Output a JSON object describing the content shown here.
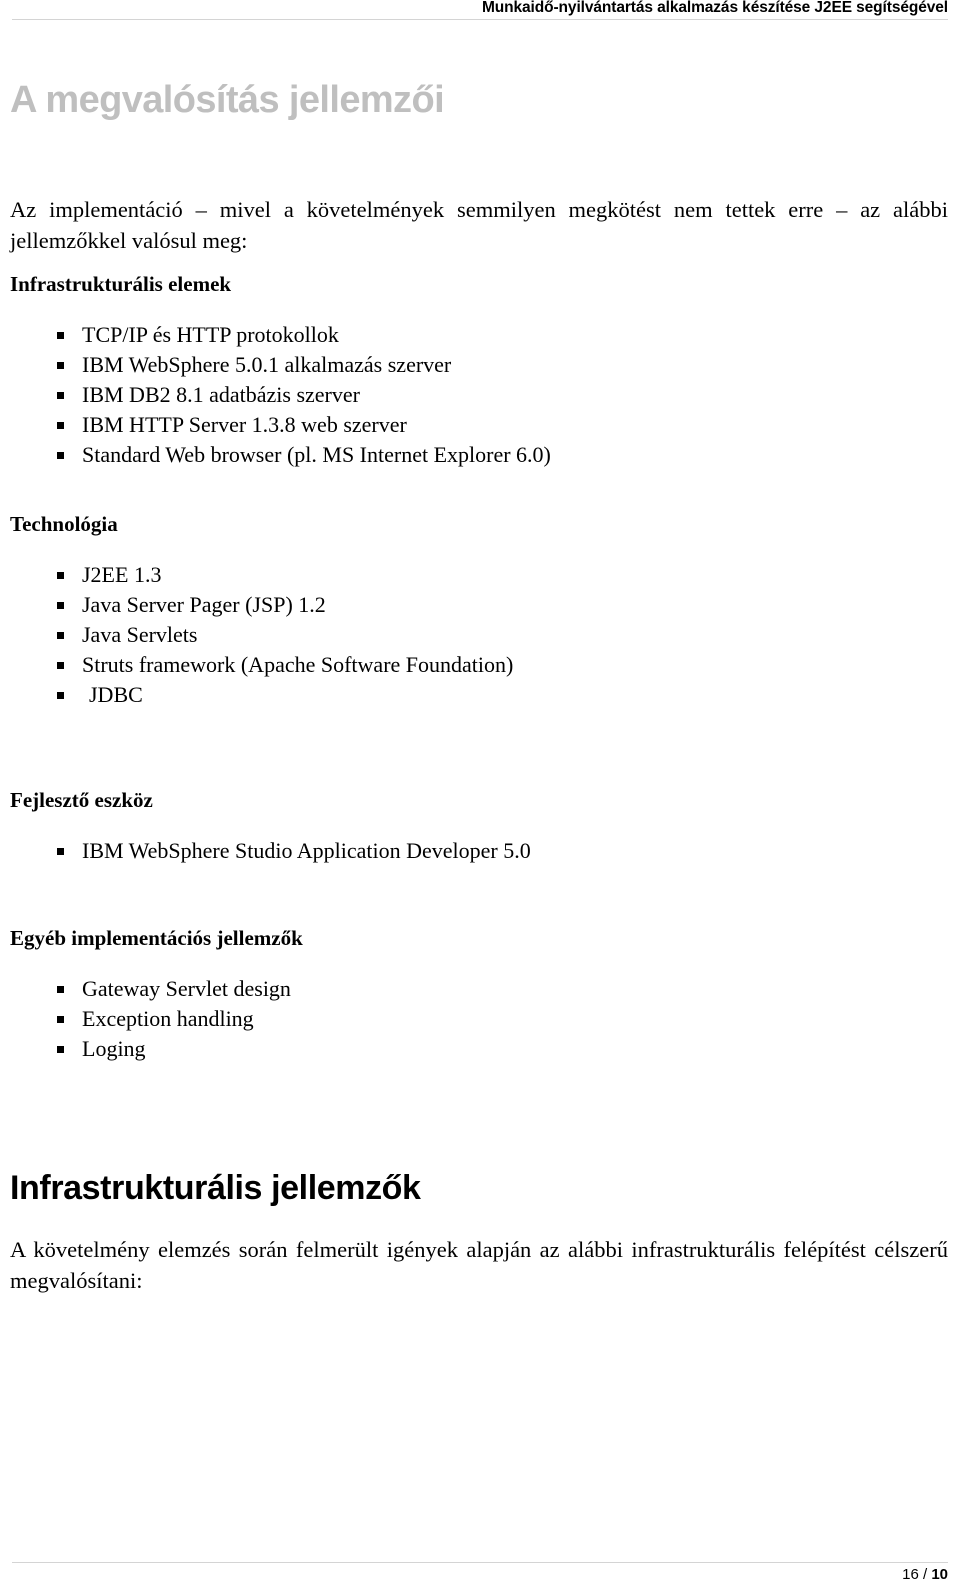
{
  "header": {
    "running_title": "Munkaidő-nyilvántartás alkalmazás készítése J2EE segítségével"
  },
  "main_title": "A megvalósítás jellemzői",
  "intro_paragraph": "Az implementáció – mivel a követelmények semmilyen megkötést nem tettek erre – az alábbi jellemzőkkel valósul meg:",
  "sections": [
    {
      "heading": "Infrastrukturális elemek",
      "items": [
        "TCP/IP és HTTP protokollok",
        "IBM WebSphere 5.0.1 alkalmazás szerver",
        "IBM DB2 8.1 adatbázis szerver",
        "IBM HTTP Server 1.3.8 web szerver",
        "Standard Web browser (pl. MS Internet Explorer 6.0)"
      ]
    },
    {
      "heading": "Technológia",
      "items": [
        "J2EE 1.3",
        "Java Server Pager (JSP) 1.2",
        "Java Servlets",
        "Struts framework (Apache Software Foundation)",
        "JDBC"
      ]
    },
    {
      "heading": "Fejlesztő eszköz",
      "items": [
        "IBM WebSphere Studio Application Developer 5.0"
      ]
    },
    {
      "heading": "Egyéb implementációs jellemzők",
      "items": [
        "Gateway Servlet design",
        "Exception handling",
        "Loging"
      ]
    }
  ],
  "bottom_title": "Infrastrukturális jellemzők",
  "bottom_paragraph": "A követelmény elemzés során felmerült igények alapján az alábbi infrastrukturális felépítést célszerű megvalósítani:",
  "footer": {
    "page_current": "16 / ",
    "page_total": "10"
  },
  "colors": {
    "title_gray": "#bfbfbf",
    "text_black": "#000000",
    "rule_gray": "#d4d4d4"
  }
}
